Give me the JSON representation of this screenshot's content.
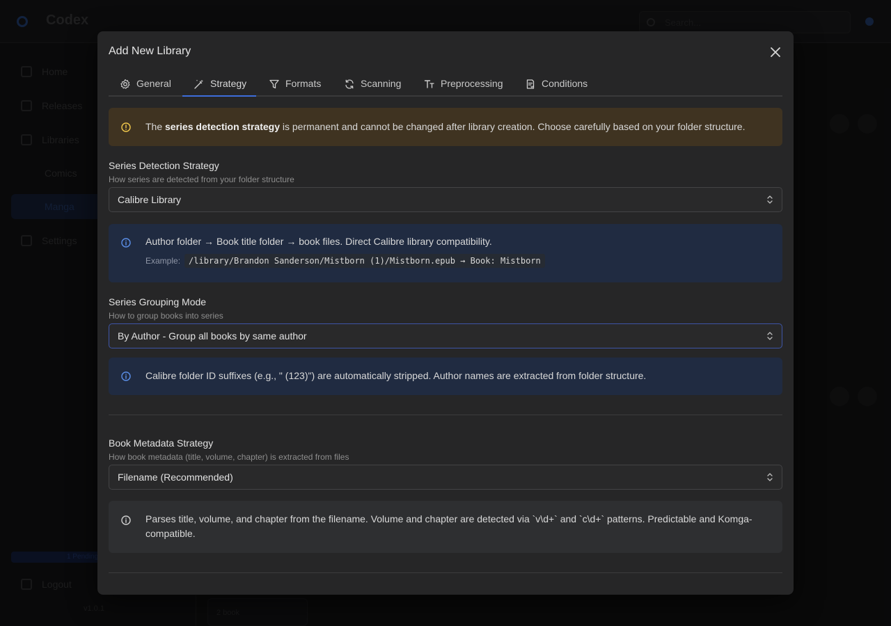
{
  "app": {
    "title": "Codex",
    "search_placeholder": "Search...",
    "sidebar": {
      "items": [
        {
          "label": "Home"
        },
        {
          "label": "Releases"
        },
        {
          "label": "Libraries"
        },
        {
          "label": "Comics"
        },
        {
          "label": "Manga"
        },
        {
          "label": "Settings"
        }
      ],
      "progress_label": "1 Pending",
      "logout_label": "Logout",
      "version": "v1.0.1"
    },
    "bg_card_label": "2 book"
  },
  "modal": {
    "title": "Add New Library",
    "tabs": [
      {
        "label": "General",
        "icon": "gear-icon"
      },
      {
        "label": "Strategy",
        "icon": "wand-icon"
      },
      {
        "label": "Formats",
        "icon": "filter-icon"
      },
      {
        "label": "Scanning",
        "icon": "refresh-icon"
      },
      {
        "label": "Preprocessing",
        "icon": "text-size-icon"
      },
      {
        "label": "Conditions",
        "icon": "checklist-icon"
      }
    ],
    "active_tab": "Strategy",
    "warning": {
      "prefix": "The ",
      "bold": "series detection strategy",
      "suffix": " is permanent and cannot be changed after library creation. Choose carefully based on your folder structure."
    },
    "series_detection": {
      "label": "Series Detection Strategy",
      "description": "How series are detected from your folder structure",
      "value": "Calibre Library",
      "info": "Author folder → Book title folder → book files. Direct Calibre library compatibility.",
      "example_label": "Example:",
      "example_code": "/library/Brandon Sanderson/Mistborn (1)/Mistborn.epub → Book: Mistborn"
    },
    "series_grouping": {
      "label": "Series Grouping Mode",
      "description": "How to group books into series",
      "value": "By Author - Group all books by same author",
      "info": "Calibre folder ID suffixes (e.g., \" (123)\") are automatically stripped. Author names are extracted from folder structure."
    },
    "book_metadata": {
      "label": "Book Metadata Strategy",
      "description": "How book metadata (title, volume, chapter) is extracted from files",
      "value": "Filename (Recommended)",
      "info": "Parses title, volume, and chapter from the filename. Volume and chapter are detected via `v\\d+` and `c\\d+` patterns. Predictable and Komga-compatible."
    }
  },
  "colors": {
    "accent": "#3d6ddb",
    "warning_bg": "#3f3321",
    "warning_icon": "#f2c94c",
    "info_bg": "#202b41",
    "info_icon": "#5b8fe8"
  }
}
